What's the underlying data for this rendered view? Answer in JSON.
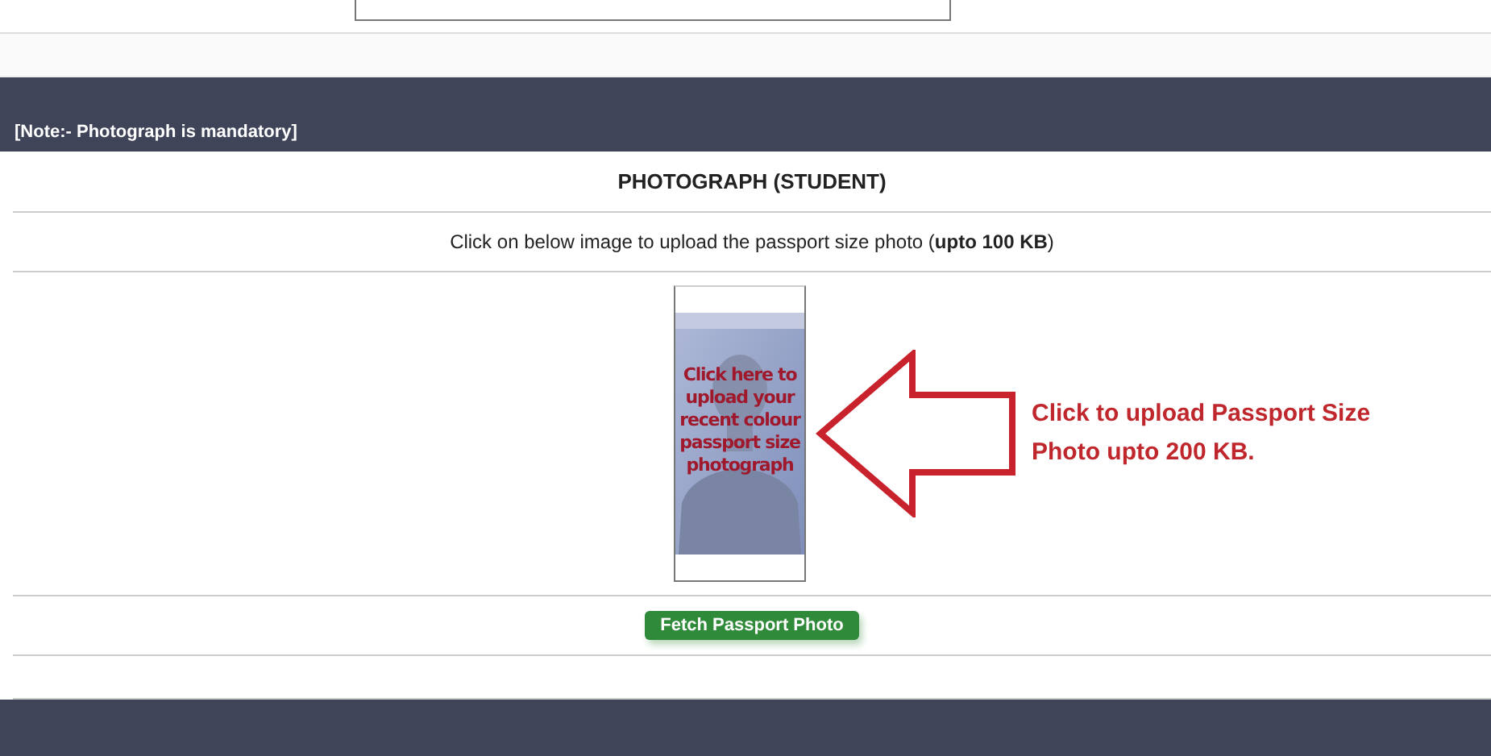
{
  "note_bar": {
    "text": "[Note:- Photograph is mandatory]"
  },
  "section": {
    "title": "PHOTOGRAPH (STUDENT)",
    "instruction": "Click on below image to upload the passport size photo (**upto 100 KB**)"
  },
  "photo_upload": {
    "overlay_text": "Click here to upload your recent colour passport size photograph"
  },
  "callout": {
    "text": "Click to upload Passport Size Photo upto 200 KB."
  },
  "fetch_button": {
    "label": "Fetch Passport Photo"
  }
}
